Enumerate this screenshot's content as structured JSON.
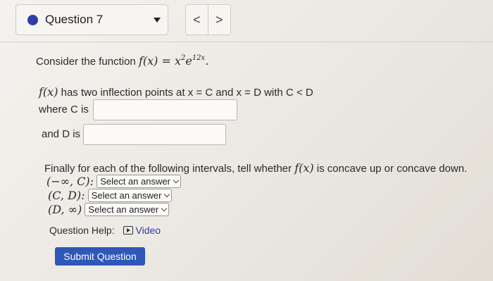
{
  "nav": {
    "question_label": "Question 7",
    "prev_symbol": "<",
    "next_symbol": ">"
  },
  "problem": {
    "intro": "Consider the function",
    "function_lhs": "f(x) = x",
    "function_exp_base": "2",
    "function_e": "e",
    "function_e_exp": "12x",
    "inflection_fx": "f(x)",
    "inflection_text": "has two inflection points at x = C and x = D with C < D",
    "where_c_label": "where C is",
    "and_d_label": "and D is",
    "where_c_value": "",
    "and_d_value": "",
    "finally_text": "Finally for each of the following intervals, tell whether",
    "finally_fx": "f(x)",
    "finally_tail": "is concave up or concave down.",
    "intervals": [
      {
        "label": "(−∞, C):",
        "answer": "Select an answer"
      },
      {
        "label": "(C, D):",
        "answer": "Select an answer"
      },
      {
        "label": "(D, ∞)",
        "answer": "Select an answer"
      }
    ]
  },
  "help": {
    "label": "Question Help:",
    "video_label": "Video"
  },
  "submit_label": "Submit Question"
}
